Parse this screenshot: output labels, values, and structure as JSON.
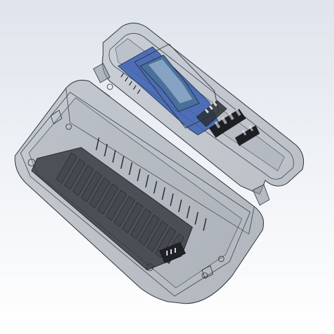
{
  "viewport": {
    "background_top": "#dfe4ec",
    "background_bottom": "#ffffff"
  },
  "model": {
    "shell_color": "#7c8794",
    "edge_color": "#2b3038",
    "connector_color": "#2e3137",
    "display_pcb_color": "#3a5fb0",
    "display_screen_color": "#4a6f9a",
    "screen_highlight_color": "#b8cde6",
    "engraved_text_color": "#1d1f23"
  }
}
